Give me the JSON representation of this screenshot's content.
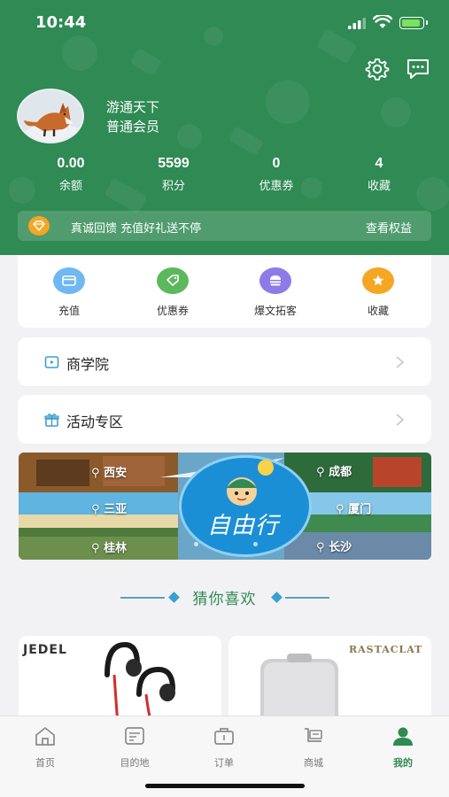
{
  "status": {
    "time": "10:44"
  },
  "profile": {
    "name": "游通天下",
    "level": "普通会员",
    "stats": [
      {
        "value": "0.00",
        "label": "余额"
      },
      {
        "value": "5599",
        "label": "积分"
      },
      {
        "value": "0",
        "label": "优惠券"
      },
      {
        "value": "4",
        "label": "收藏"
      }
    ]
  },
  "promo": {
    "text": "真诚回馈 充值好礼送不停",
    "link": "查看权益"
  },
  "quick_actions": [
    {
      "label": "充值",
      "icon": "wallet-icon",
      "color": "#6fb8f2"
    },
    {
      "label": "优惠券",
      "icon": "tag-icon",
      "color": "#5cb85c"
    },
    {
      "label": "爆文拓客",
      "icon": "burger-icon",
      "color": "#8e7ae8"
    },
    {
      "label": "收藏",
      "icon": "star-icon",
      "color": "#f5a623"
    }
  ],
  "menu": [
    {
      "label": "商学院",
      "icon": "academy-icon"
    },
    {
      "label": "活动专区",
      "icon": "gift-icon"
    }
  ],
  "banner": {
    "cities": [
      "西安",
      "三亚",
      "桂林",
      "成都",
      "厦门",
      "长沙"
    ],
    "slogan": "自由行"
  },
  "section_title": "猜你喜欢",
  "products": [
    {
      "brand": "JEDEL"
    },
    {
      "brand": "RASTACLAT"
    }
  ],
  "tabs": [
    {
      "label": "首页",
      "icon": "home-icon"
    },
    {
      "label": "目的地",
      "icon": "destination-icon"
    },
    {
      "label": "订单",
      "icon": "order-icon"
    },
    {
      "label": "商城",
      "icon": "mall-icon"
    },
    {
      "label": "我的",
      "icon": "profile-icon"
    }
  ],
  "colors": {
    "primary": "#2f8a54",
    "accent": "#3a9fd0",
    "background": "#f2f2f4"
  }
}
